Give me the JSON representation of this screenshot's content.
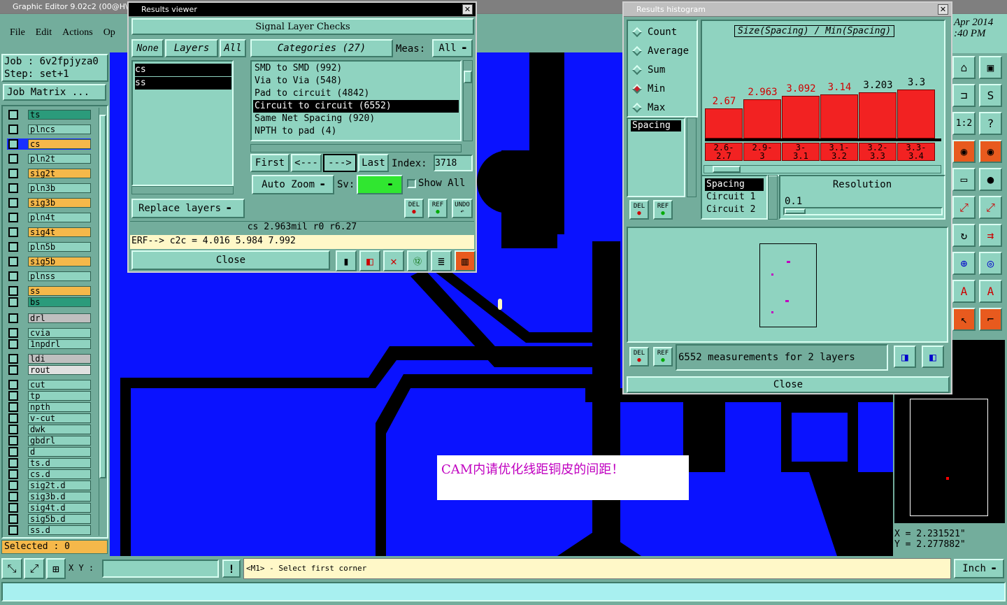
{
  "app": {
    "title": "Graphic Editor 9.02c2 (00@H\\",
    "date": "Apr 2014",
    "time": ":40 PM"
  },
  "menu": [
    "File",
    "Edit",
    "Actions",
    "Op"
  ],
  "job": {
    "job_label": "Job  : 6v2fpjyza0",
    "step_label": "Step: set+1",
    "matrix_button": "Job Matrix ..."
  },
  "layers": [
    {
      "name": "ts",
      "color": "#2b9b7b"
    },
    {
      "name": "plncs",
      "color": "#8fd3c0"
    },
    {
      "name": "cs",
      "color": "#f5b84a",
      "active": true
    },
    {
      "name": "pln2t",
      "color": "#8fd3c0"
    },
    {
      "name": "sig2t",
      "color": "#f5b84a"
    },
    {
      "name": "pln3b",
      "color": "#8fd3c0"
    },
    {
      "name": "sig3b",
      "color": "#f5b84a"
    },
    {
      "name": "pln4t",
      "color": "#8fd3c0"
    },
    {
      "name": "sig4t",
      "color": "#f5b84a"
    },
    {
      "name": "pln5b",
      "color": "#8fd3c0"
    },
    {
      "name": "sig5b",
      "color": "#f5b84a"
    },
    {
      "name": "plnss",
      "color": "#8fd3c0"
    },
    {
      "name": "ss",
      "color": "#f5b84a"
    },
    {
      "name": "bs",
      "color": "#2b9b7b"
    },
    {
      "name": "drl",
      "color": "#bfbfbf"
    },
    {
      "name": "cvia",
      "color": "#8fd3c0"
    },
    {
      "name": "1npdrl",
      "color": "#8fd3c0"
    },
    {
      "name": "ldi",
      "color": "#bfbfbf"
    },
    {
      "name": "rout",
      "color": "#e0e0e0"
    },
    {
      "name": "cut",
      "color": "#8fd3c0"
    },
    {
      "name": "tp",
      "color": "#8fd3c0"
    },
    {
      "name": "npth",
      "color": "#8fd3c0"
    },
    {
      "name": "v-cut",
      "color": "#8fd3c0"
    },
    {
      "name": "dwk",
      "color": "#8fd3c0"
    },
    {
      "name": "gbdrl",
      "color": "#8fd3c0"
    },
    {
      "name": "d",
      "color": "#8fd3c0"
    },
    {
      "name": "ts.d",
      "color": "#8fd3c0"
    },
    {
      "name": "cs.d",
      "color": "#8fd3c0"
    },
    {
      "name": "sig2t.d",
      "color": "#8fd3c0"
    },
    {
      "name": "sig3b.d",
      "color": "#8fd3c0"
    },
    {
      "name": "sig4t.d",
      "color": "#8fd3c0"
    },
    {
      "name": "sig5b.d",
      "color": "#8fd3c0"
    },
    {
      "name": "ss.d",
      "color": "#8fd3c0"
    }
  ],
  "selected_label": "Selected : 0",
  "results": {
    "window_title": "Results viewer",
    "header": "Signal Layer Checks",
    "none_btn": "None",
    "layers_btn": "Layers",
    "all_btn": "All",
    "categories_btn": "Categories (27)",
    "meas_label": "Meas:",
    "meas_value": "All",
    "layer_list": [
      "cs",
      "ss"
    ],
    "categories": [
      "SMD to SMD (992)",
      "Via to Via (548)",
      "Pad to circuit (4842)",
      "Circuit to circuit (6552)",
      "Same Net Spacing (920)",
      "NPTH to pad (4)"
    ],
    "selected_category": 3,
    "first": "First",
    "prev": "<---",
    "next": "--->",
    "last": "Last",
    "index_label": "Index:",
    "index_value": "3718",
    "auto_zoom": "Auto Zoom",
    "sv_label": "Sv:",
    "show_all": "Show All",
    "replace_layers": "Replace layers",
    "del": "DEL",
    "ref": "REF",
    "undo": "UNDO",
    "status": "cs 2.963mil  r0  r6.27",
    "erf": "ERF--> c2c = 4.016 5.984 7.992",
    "close": "Close"
  },
  "histogram": {
    "window_title": "Results histogram",
    "modes": [
      "Count",
      "Average",
      "Sum",
      "Min",
      "Max"
    ],
    "selected_mode": "Min",
    "measure_list": [
      "Spacing"
    ],
    "chart_title": "Size(Spacing) / Min(Spacing)",
    "fields": [
      "Spacing",
      "Circuit 1",
      "Circuit 2"
    ],
    "resolution_label": "Resolution",
    "resolution_value": "0.1",
    "del": "DEL",
    "ref": "REF",
    "summary": "6552 measurements for 2 layers",
    "close": "Close"
  },
  "chart_data": {
    "type": "bar",
    "title": "Size(Spacing) / Min(Spacing)",
    "categories": [
      "2.6-2.7",
      "2.9-3",
      "3-3.1",
      "3.1-3.2",
      "3.2-3.3",
      "3.3-3.4"
    ],
    "category_lines": [
      [
        "2.6-",
        "2.7"
      ],
      [
        "2.9-",
        "3"
      ],
      [
        "3-",
        "3.1"
      ],
      [
        "3.1-",
        "3.2"
      ],
      [
        "3.2-",
        "3.3"
      ],
      [
        "3.3-",
        "3.4"
      ]
    ],
    "values": [
      2.67,
      2.963,
      3.092,
      3.14,
      3.203,
      3.3
    ],
    "value_labels": [
      "2.67",
      "2.963",
      "3.092",
      "3.14",
      "3.203",
      "3.3"
    ],
    "ylim": [
      0,
      3.3
    ]
  },
  "canvas": {
    "note": "CAM内请优化线距铜皮的间距！"
  },
  "coords": {
    "x": "X = 2.231521\"",
    "y": "Y = 2.277882\""
  },
  "bottom": {
    "xy_label": "X Y :",
    "xy_value": "",
    "message": "<M1> - Select first corner",
    "unit": "Inch"
  },
  "colors": {
    "panel": "#8fd3c0",
    "board": "#0a12ff",
    "accent_red": "#f22222"
  }
}
